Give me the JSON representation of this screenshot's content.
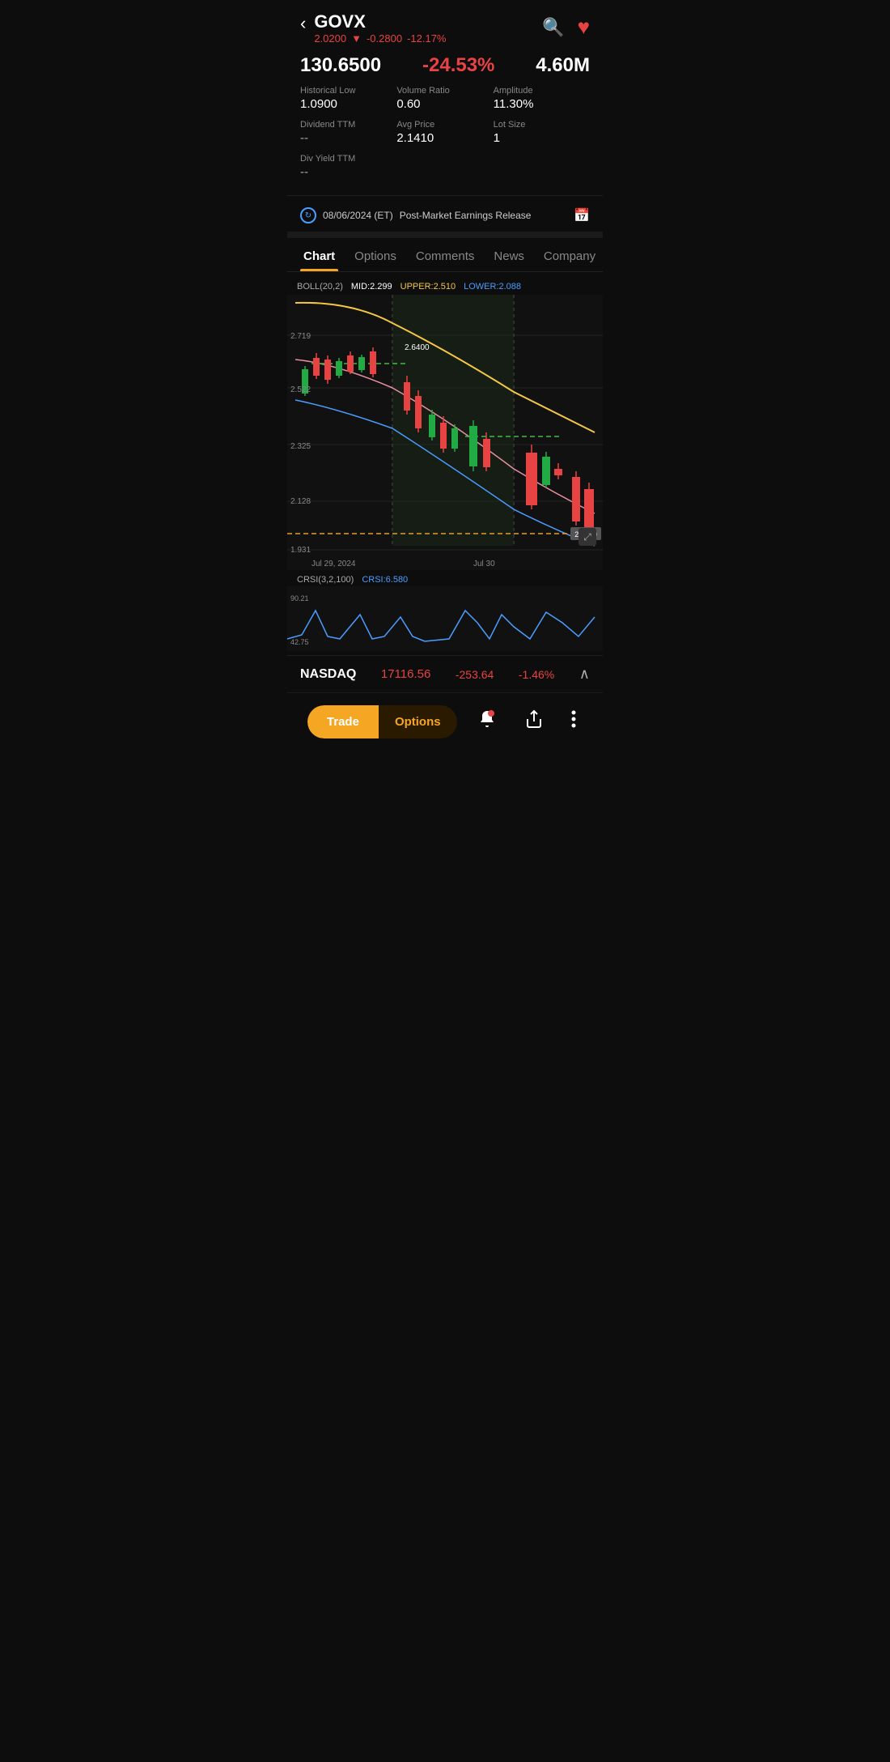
{
  "header": {
    "back_label": "‹",
    "ticker": "GOVX",
    "price": "2.0200",
    "price_arrow": "▼",
    "price_change": "-0.2800",
    "price_pct": "-12.17%",
    "search_icon": "🔍",
    "heart_icon": "♥"
  },
  "stats": {
    "hist_low_label": "Historical Low",
    "hist_low_val": "1.0900",
    "vol_ratio_label": "Volume Ratio",
    "vol_ratio_val": "0.60",
    "amplitude_label": "Amplitude",
    "amplitude_val": "11.30%",
    "dividend_label": "Dividend TTM",
    "dividend_val": "--",
    "avg_price_label": "Avg Price",
    "avg_price_val": "2.1410",
    "lot_size_label": "Lot Size",
    "lot_size_val": "1",
    "div_yield_label": "Div Yield TTM",
    "div_yield_val": "--",
    "main_val1": "130.6500",
    "main_val2": "-24.53%",
    "main_val3": "4.60M"
  },
  "earnings": {
    "date": "08/06/2024 (ET)",
    "label": "Post-Market Earnings Release"
  },
  "tabs": [
    {
      "id": "chart",
      "label": "Chart",
      "active": true
    },
    {
      "id": "options",
      "label": "Options",
      "active": false
    },
    {
      "id": "comments",
      "label": "Comments",
      "active": false
    },
    {
      "id": "news",
      "label": "News",
      "active": false
    },
    {
      "id": "company",
      "label": "Company",
      "active": false
    }
  ],
  "chart": {
    "boll_label": "BOLL(20,2)",
    "mid_label": "MID:2.299",
    "upper_label": "UPPER:2.510",
    "lower_label": "LOWER:2.088",
    "y_labels": [
      "2.719",
      "2.522",
      "2.325",
      "2.128",
      "1.931"
    ],
    "x_labels": [
      "Jul 29, 2024",
      "Jul 30"
    ],
    "price_line_val": "2.0100",
    "callout_val": "2.6400",
    "expand_icon": "⤢"
  },
  "crsi": {
    "label": "CRSI(3,2,100)",
    "val_label": "CRSI:6.580",
    "y_label": "90.21",
    "y_label2": "42.75"
  },
  "nasdaq": {
    "name": "NASDAQ",
    "price": "17116.56",
    "change": "-253.64",
    "pct": "-1.46%",
    "chevron": "∧"
  },
  "bottom_nav": {
    "trade_label": "Trade",
    "options_label": "Options",
    "alert_icon": "🔔",
    "share_icon": "⬆",
    "more_icon": "⋮"
  }
}
